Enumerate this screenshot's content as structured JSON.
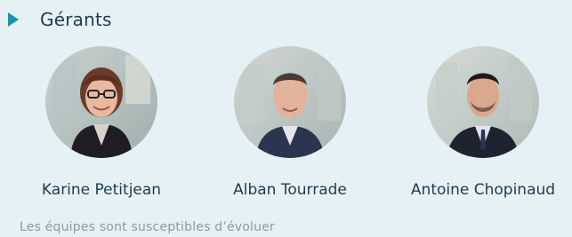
{
  "section": {
    "title": "Gérants",
    "bullet_icon": "triangle-right-icon",
    "accent_color": "#1f8fb0"
  },
  "managers": [
    {
      "name": "Karine Petitjean",
      "avatar": "portrait-photo"
    },
    {
      "name": "Alban Tourrade",
      "avatar": "portrait-photo"
    },
    {
      "name": "Antoine Chopinaud",
      "avatar": "portrait-photo"
    }
  ],
  "note": "Les équipes sont susceptibles d’évoluer"
}
